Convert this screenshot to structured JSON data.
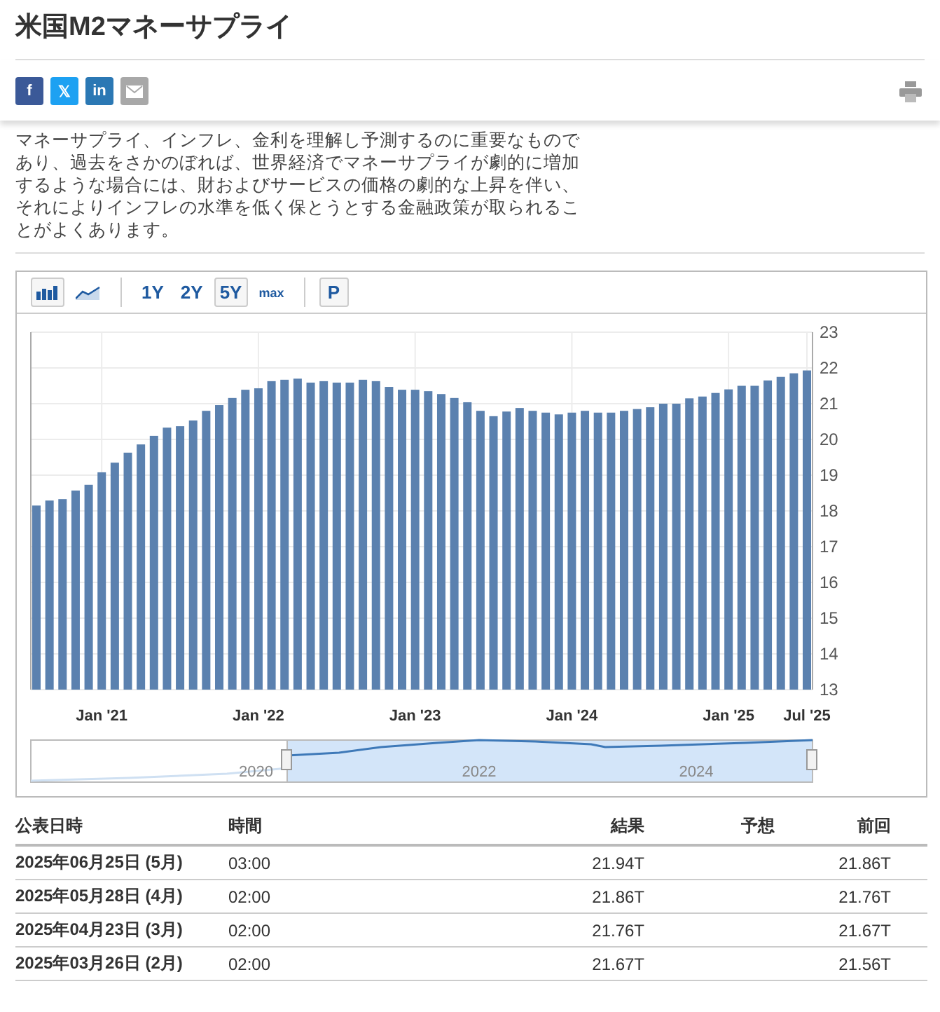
{
  "title": "米国M2マネーサプライ",
  "share_buttons": [
    {
      "kind": "facebook",
      "glyph": "f"
    },
    {
      "kind": "x",
      "glyph": "𝕏"
    },
    {
      "kind": "linkedin",
      "glyph": "in"
    },
    {
      "kind": "email"
    }
  ],
  "description": "マネーサプライ、インフレ、金利を理解し予測するのに重要なものであり、過去をさかのぼれば、世界経済でマネーサプライが劇的に増加するような場合には、財およびサービスの価格の劇的な上昇を伴い、それによりインフレの水準を低く保とうとする金融政策が取られることがよくあります。",
  "chart_toolbar": {
    "chart_types": [
      {
        "kind": "bar",
        "selected": true
      },
      {
        "kind": "area",
        "selected": false
      }
    ],
    "ranges": [
      {
        "label": "1Y",
        "selected": false
      },
      {
        "label": "2Y",
        "selected": false
      },
      {
        "label": "5Y",
        "selected": true
      },
      {
        "label": "max",
        "selected": false
      }
    ],
    "p_button": {
      "label": "P"
    }
  },
  "chart": {
    "chart_data": {
      "type": "bar",
      "categories": [
        null,
        null,
        null,
        null,
        null,
        "Jan '21",
        null,
        null,
        null,
        null,
        null,
        null,
        null,
        null,
        null,
        null,
        null,
        "Jan '22",
        null,
        null,
        null,
        null,
        null,
        null,
        null,
        null,
        null,
        null,
        null,
        "Jan '23",
        null,
        null,
        null,
        null,
        null,
        null,
        null,
        null,
        null,
        null,
        null,
        "Jan '24",
        null,
        null,
        null,
        null,
        null,
        null,
        null,
        null,
        null,
        null,
        null,
        "Jan '25",
        null,
        null,
        null,
        null,
        null,
        "Jul '25"
      ],
      "grid": true,
      "series": [
        {
          "color": "#5b81af",
          "values": [
            18.15,
            18.29,
            18.33,
            18.57,
            18.73,
            19.08,
            19.35,
            19.63,
            19.86,
            20.1,
            20.33,
            20.37,
            20.53,
            20.8,
            20.96,
            21.16,
            21.39,
            21.43,
            21.63,
            21.67,
            21.7,
            21.59,
            21.63,
            21.59,
            21.59,
            21.67,
            21.63,
            21.47,
            21.39,
            21.39,
            21.35,
            21.27,
            21.16,
            21.04,
            20.8,
            20.65,
            20.78,
            20.88,
            20.8,
            20.75,
            20.7,
            20.75,
            20.8,
            20.75,
            20.75,
            20.8,
            20.85,
            20.9,
            21.0,
            21.0,
            21.15,
            21.2,
            21.3,
            21.4,
            21.5,
            21.5,
            21.65,
            21.75,
            21.85,
            21.93
          ]
        }
      ],
      "ylim": [
        13,
        23
      ],
      "yticks": [
        13,
        14,
        15,
        16,
        17,
        18,
        19,
        20,
        21,
        22,
        23
      ]
    },
    "navigator": {
      "labels": [
        "2020",
        "2022",
        "2024"
      ]
    }
  },
  "table": {
    "columns": [
      "公表日時",
      "時間",
      "結果",
      "予想",
      "前回"
    ],
    "rows": [
      {
        "date": "2025年06月25日 (5月)",
        "time": "03:00",
        "actual": "21.94T",
        "previous": "21.86T"
      },
      {
        "date": "2025年05月28日 (4月)",
        "time": "02:00",
        "actual": "21.86T",
        "previous": "21.76T"
      },
      {
        "date": "2025年04月23日 (3月)",
        "time": "02:00",
        "actual": "21.76T",
        "previous": "21.67T"
      },
      {
        "date": "2025年03月26日 (2月)",
        "time": "02:00",
        "actual": "21.67T",
        "previous": "21.56T"
      }
    ]
  }
}
